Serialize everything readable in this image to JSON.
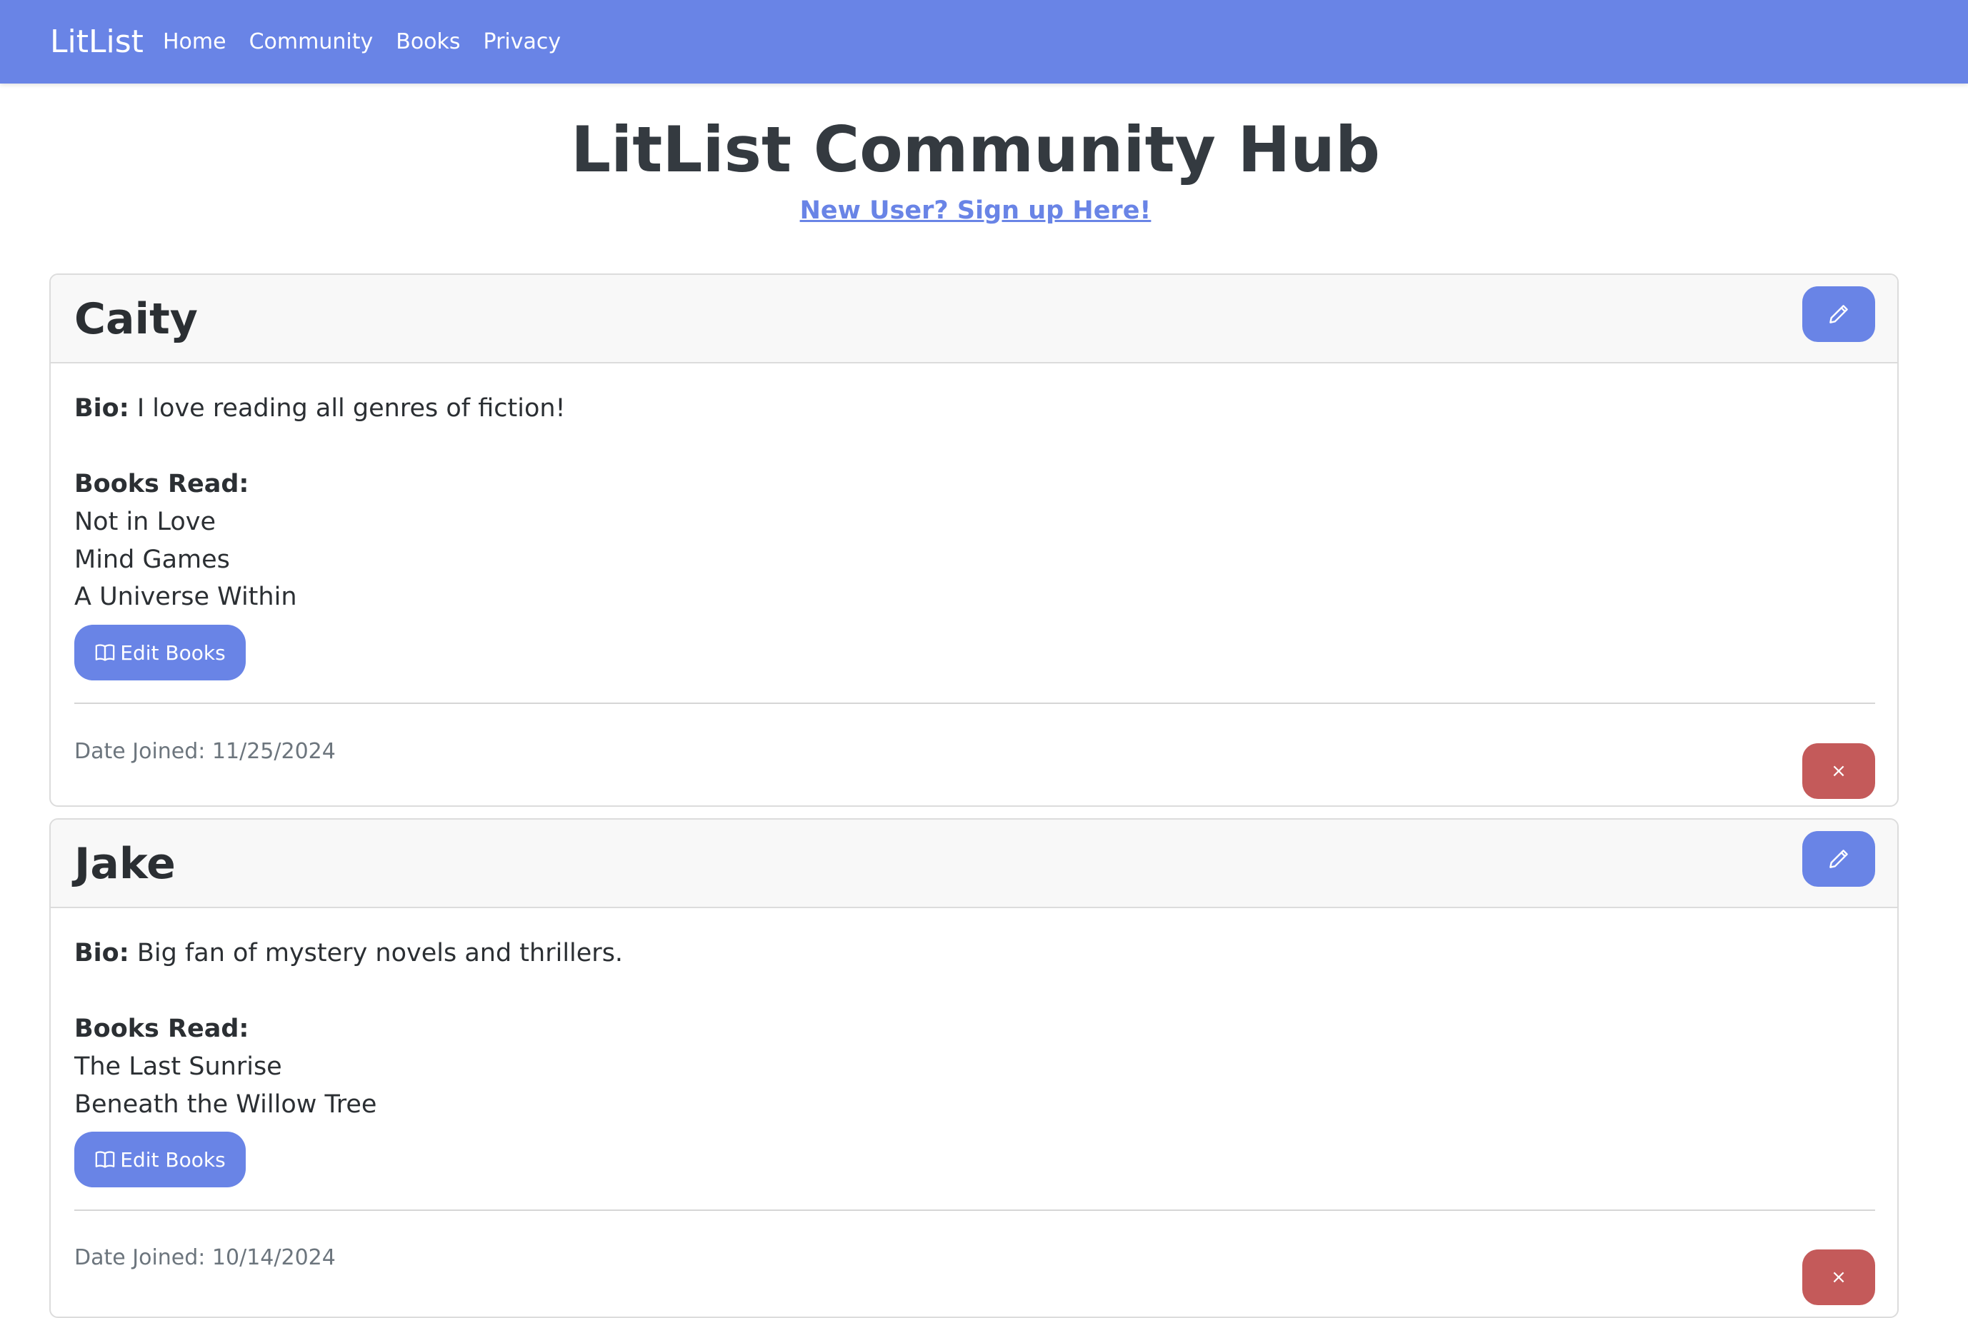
{
  "navbar": {
    "brand": "LitList",
    "links": [
      "Home",
      "Community",
      "Books",
      "Privacy"
    ]
  },
  "hero": {
    "title": "LitList Community Hub",
    "signup_link": "New User? Sign up Here!"
  },
  "labels": {
    "bio": "Bio:",
    "books_read": "Books Read:",
    "edit_books": "Edit Books",
    "delete_glyph": "×"
  },
  "users": [
    {
      "name": "Caity",
      "bio": "I love reading all genres of fiction!",
      "books": [
        "Not in Love",
        "Mind Games",
        "A Universe Within"
      ],
      "date_joined": "Date Joined: 11/25/2024"
    },
    {
      "name": "Jake",
      "bio": "Big fan of mystery novels and thrillers.",
      "books": [
        "The Last Sunrise",
        "Beneath the Willow Tree"
      ],
      "date_joined": "Date Joined: 10/14/2024"
    }
  ],
  "icons": {
    "edit_user": "pencil-icon",
    "edit_books": "book-icon",
    "delete": "close-icon"
  },
  "colors": {
    "primary": "#6984e6",
    "danger": "#c45a5a",
    "muted_text": "#6c757d"
  }
}
